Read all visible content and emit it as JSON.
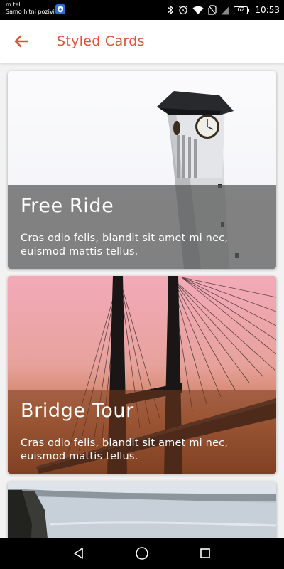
{
  "status_bar": {
    "carrier_line1": "m:tel",
    "carrier_line2": "Samo hitni pozivi",
    "battery_level": "62",
    "time": "10:53",
    "icons": [
      "shield-app-icon",
      "bluetooth-icon",
      "alarm-icon",
      "wifi-icon",
      "no-sim-icon",
      "signal-icon",
      "battery-icon"
    ]
  },
  "app_bar": {
    "title": "Styled Cards",
    "back_icon": "arrow-left-icon",
    "accent_color": "#d9573b"
  },
  "cards": [
    {
      "title": "Free Ride",
      "description": "Cras odio felis, blandit sit amet mi nec, euismod mattis tellus.",
      "image": "clock-tower-photo"
    },
    {
      "title": "Bridge Tour",
      "description": "Cras odio felis, blandit sit amet mi nec, euismod mattis tellus.",
      "image": "suspension-bridge-photo"
    },
    {
      "title": "",
      "description": "",
      "image": "coastline-photo"
    }
  ],
  "nav_bar": {
    "icons": [
      "triangle-back-icon",
      "circle-home-icon",
      "square-recents-icon"
    ]
  }
}
